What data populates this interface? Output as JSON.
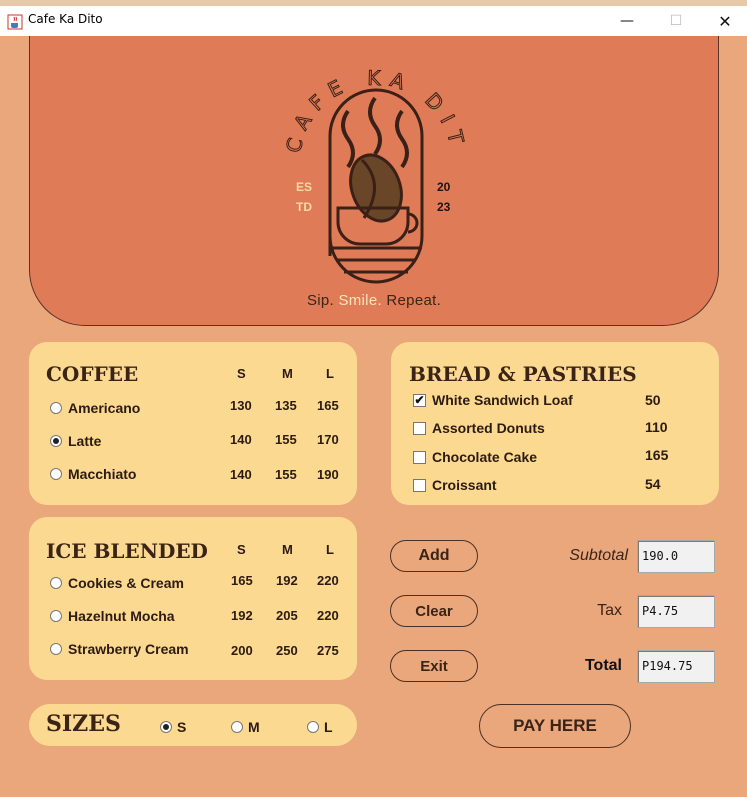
{
  "window": {
    "title": "Cafe Ka Dito",
    "controls": {
      "minimize": "—",
      "maximize": "☐",
      "close": "✕"
    }
  },
  "hero": {
    "logo_arc_text": "CAFE KA DITO",
    "est_left_1": "ES",
    "est_left_2": "TD",
    "est_right_1": "20",
    "est_right_2": "23",
    "tagline_part1": "Sip. ",
    "tagline_smile": "Smile.",
    "tagline_part2": " Repeat."
  },
  "coffee": {
    "heading": "COFFEE",
    "sizes": [
      "S",
      "M",
      "L"
    ],
    "items": [
      {
        "name": "Americano",
        "selected": false,
        "prices": [
          "130",
          "135",
          "165"
        ]
      },
      {
        "name": "Latte",
        "selected": true,
        "prices": [
          "140",
          "155",
          "170"
        ]
      },
      {
        "name": "Macchiato",
        "selected": false,
        "prices": [
          "140",
          "155",
          "190"
        ]
      }
    ]
  },
  "bread": {
    "heading": "BREAD & PASTRIES",
    "items": [
      {
        "name": "White Sandwich Loaf",
        "checked": true,
        "price": "50"
      },
      {
        "name": "Assorted Donuts",
        "checked": false,
        "price": "110"
      },
      {
        "name": "Chocolate Cake",
        "checked": false,
        "price": "165"
      },
      {
        "name": "Croissant",
        "checked": false,
        "price": "54"
      }
    ]
  },
  "ice": {
    "heading": "ICE BLENDED",
    "sizes": [
      "S",
      "M",
      "L"
    ],
    "items": [
      {
        "name": "Cookies & Cream",
        "selected": false,
        "prices": [
          "165",
          "192",
          "220"
        ]
      },
      {
        "name": "Hazelnut Mocha",
        "selected": false,
        "prices": [
          "192",
          "205",
          "220"
        ]
      },
      {
        "name": "Strawberry Cream",
        "selected": false,
        "prices": [
          "200",
          "250",
          "275"
        ]
      }
    ]
  },
  "sizes": {
    "heading": "SIZES",
    "options": [
      {
        "label": "S",
        "selected": true
      },
      {
        "label": "M",
        "selected": false
      },
      {
        "label": "L",
        "selected": false
      }
    ]
  },
  "actions": {
    "add": "Add",
    "clear": "Clear",
    "exit": "Exit",
    "pay": "PAY HERE"
  },
  "totals": {
    "subtotal_label": "Subtotal",
    "subtotal_value": "190.0",
    "tax_label": "Tax",
    "tax_value": "P4.75",
    "total_label": "Total",
    "total_value": "P194.75"
  },
  "colors": {
    "background": "#eaa77c",
    "hero": "#e07b58",
    "panel": "#fcd990",
    "text_dark": "#3a2416",
    "accent_cream": "#f7e6b8"
  }
}
